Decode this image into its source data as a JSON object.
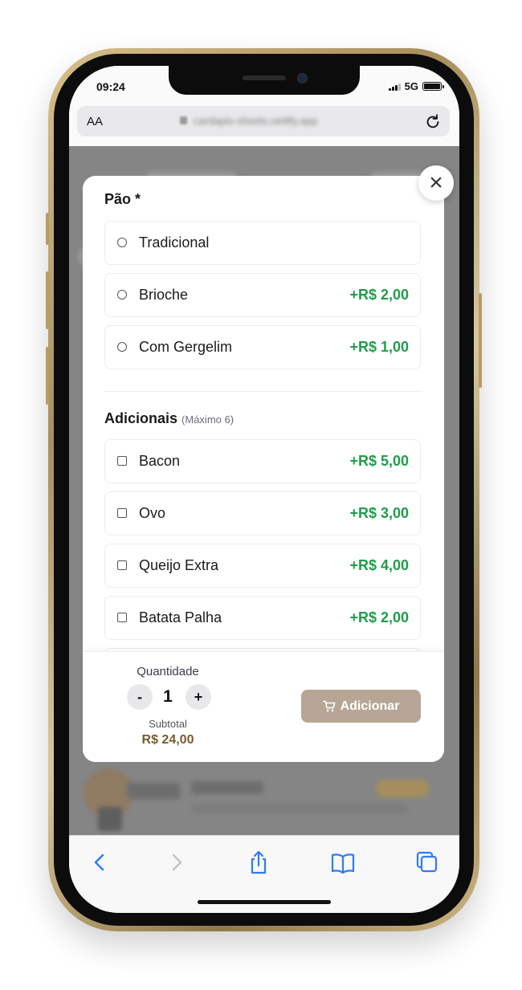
{
  "status_bar": {
    "time": "09:24",
    "network": "5G"
  },
  "browser": {
    "text_size_label": "AA",
    "url": "cardapio-sheets.netlify.app"
  },
  "modal": {
    "close_symbol": "×",
    "sections": [
      {
        "title": "Pão *",
        "hint": "",
        "input_type": "radio",
        "options": [
          {
            "label": "Tradicional",
            "price": ""
          },
          {
            "label": "Brioche",
            "price": "+R$ 2,00"
          },
          {
            "label": "Com Gergelim",
            "price": "+R$ 1,00"
          }
        ]
      },
      {
        "title": "Adicionais",
        "hint": "(Máximo 6)",
        "input_type": "checkbox",
        "options": [
          {
            "label": "Bacon",
            "price": "+R$ 5,00"
          },
          {
            "label": "Ovo",
            "price": "+R$ 3,00"
          },
          {
            "label": "Queijo Extra",
            "price": "+R$ 4,00"
          },
          {
            "label": "Batata Palha",
            "price": "+R$ 2,00"
          }
        ]
      }
    ],
    "footer": {
      "quantity_label": "Quantidade",
      "decrement": "-",
      "quantity": "1",
      "increment": "+",
      "subtotal_label": "Subtotal",
      "subtotal_value": "R$ 24,00",
      "add_label": "Adicionar"
    }
  },
  "colors": {
    "price": "#1f9d4a",
    "subtotal": "#7a5a2c",
    "add_button": "#b7a595"
  },
  "toolbar": {
    "icons": [
      "back-icon",
      "forward-icon",
      "share-icon",
      "bookmarks-icon",
      "tabs-icon"
    ]
  }
}
